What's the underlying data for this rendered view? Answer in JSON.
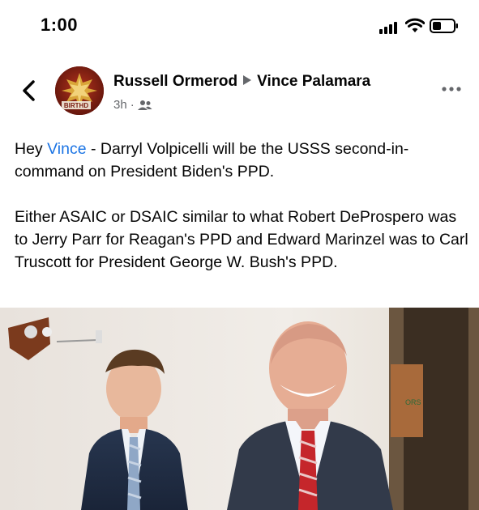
{
  "status_bar": {
    "time": "1:00"
  },
  "post": {
    "author": "Russell Ormerod",
    "recipient": "Vince Palamara",
    "timestamp": "3h",
    "meta_dot": "·",
    "avatar_text": "BIRTHD",
    "paragraph1": {
      "greeting": "Hey ",
      "mention": "Vince",
      "rest": " - Darryl Volpicelli will be the USSS second-in-command on President Biden's PPD."
    },
    "paragraph2": "Either ASAIC or DSAIC similar to what Robert DeProspero was to Jerry Parr for Reagan's PPD and Edward Marinzel was to Carl Truscott for President George W. Bush's PPD.",
    "photo_sign_text": "ORS"
  },
  "icons": {
    "back": "chevron-left-icon",
    "more": "more-horizontal-icon",
    "audience": "friends-icon",
    "share_arrow": "caret-right-icon"
  },
  "colors": {
    "mention": "#1b74e4",
    "meta": "#65676b",
    "text": "#050505"
  }
}
